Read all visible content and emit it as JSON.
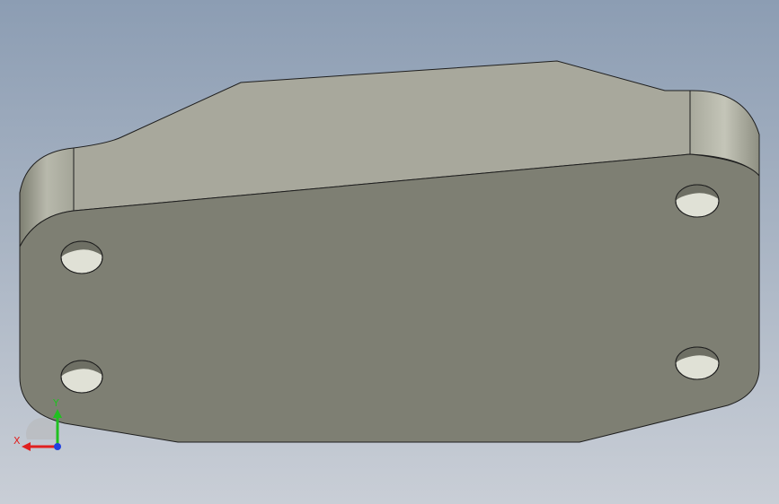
{
  "viewport": {
    "background_top": "#8c9db3",
    "background_bottom": "#c9ced6"
  },
  "part": {
    "top_face_color": "#a8a89c",
    "front_face_color": "#7e7f73",
    "side_face_color": "#9c9d90",
    "edge_color": "#1e1e1e"
  },
  "triad": {
    "x_label": "X",
    "y_label": "Y",
    "x_color": "#e02020",
    "y_color": "#20c020",
    "z_color": "#2040e0"
  }
}
